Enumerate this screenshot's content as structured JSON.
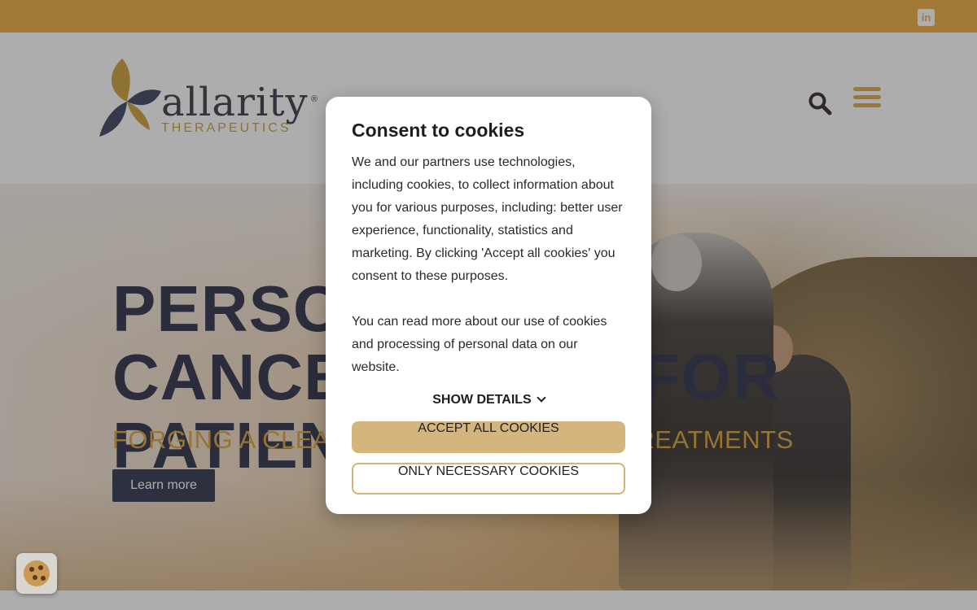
{
  "topbar": {
    "linkedin_icon": "linkedin-icon",
    "linkedin_glyph": "in"
  },
  "header": {
    "logo_word": "allarity",
    "logo_sub": "THERAPEUTICS",
    "logo_reg": "®",
    "search_icon": "search-icon",
    "menu_icon": "hamburger-menu-icon"
  },
  "hero": {
    "title": "PERSONALIZED CANCER CARE. FOR PATIENTS.",
    "subtitle": "FORGING A CLEAR PATH TO EFFECTIVE TREATMENTS",
    "cta_label": "Learn more"
  },
  "cookie_modal": {
    "title": "Consent to cookies",
    "paragraph1": "We and our partners use technologies, including cookies, to collect information about you for various purposes, including: better user experience, functionality, statistics and marketing. By clicking 'Accept all cookies' you consent to these purposes.",
    "paragraph2": "You can read more about our use of cookies and processing of personal data on our website.",
    "show_details": "SHOW DETAILS",
    "accept_all": "ACCEPT ALL COOKIES",
    "only_necessary": "ONLY NECESSARY COOKIES"
  },
  "cookie_settings_icon": "cookie-icon",
  "colors": {
    "accent_gold": "#e8a832",
    "navy": "#20233d",
    "button_gold": "#d4b57e"
  }
}
